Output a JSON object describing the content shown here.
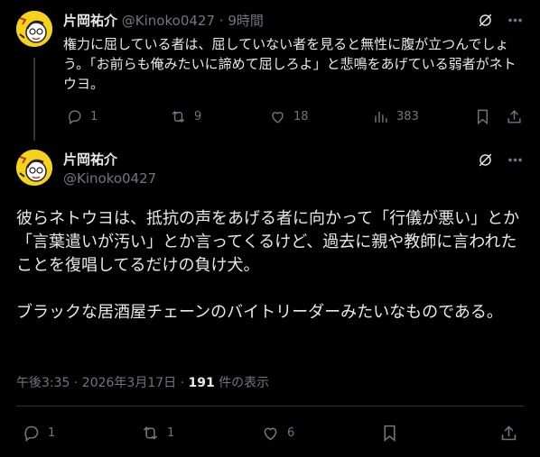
{
  "post1": {
    "author_name": "片岡祐介",
    "handle": "@Kinoko0427",
    "separator": "·",
    "time": "9時間",
    "text": "権力に屈している者は、屈していない者を見ると無性に腹が立つんでしょう。「お前らも俺みたいに諦めて屈しろよ」と悲鳴をあげている弱者がネトウヨ。",
    "counts": {
      "replies": "1",
      "reposts": "9",
      "likes": "18",
      "views": "383"
    }
  },
  "post2": {
    "author_name": "片岡祐介",
    "handle": "@Kinoko0427",
    "text": "彼らネトウヨは、抵抗の声をあげる者に向かって「行儀が悪い」とか「言葉遣いが汚い」とか言ってくるけど、過去に親や教師に言われたことを復唱してるだけの負け犬。\n\nブラックな居酒屋チェーンのバイトリーダーみたいなものである。",
    "timestamp": "午後3:35 · 2026年3月17日 · ",
    "view_count": "191",
    "view_label": " 件の表示",
    "counts": {
      "replies": "1",
      "reposts": "1",
      "likes": "6"
    }
  },
  "colors": {
    "background": "#000000",
    "text": "#e7e9ea",
    "muted": "#71767b",
    "divider": "#2f3336",
    "avatar": "#f5d31a"
  }
}
